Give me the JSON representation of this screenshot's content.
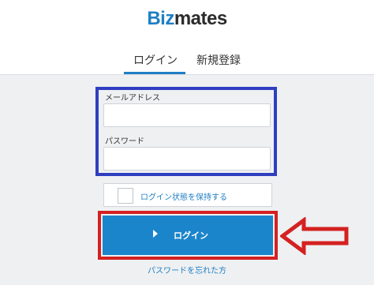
{
  "brand": {
    "logo_part1": "Biz",
    "logo_part2": "mates",
    "accent": "#1f7fc4"
  },
  "tabs": [
    {
      "label": "ログイン",
      "active": true
    },
    {
      "label": "新規登録",
      "active": false
    }
  ],
  "form": {
    "email_label": "メールアドレス",
    "email_value": "",
    "password_label": "パスワード",
    "password_value": "",
    "remember_label": "ログイン状態を保持する",
    "remember_checked": false,
    "submit_label": "ログイン",
    "forgot_label": "パスワードを忘れた方"
  },
  "annotations": {
    "credentials_box_color": "#2f3ec0",
    "button_box_color": "#d42121",
    "arrow_color": "#d42121"
  }
}
